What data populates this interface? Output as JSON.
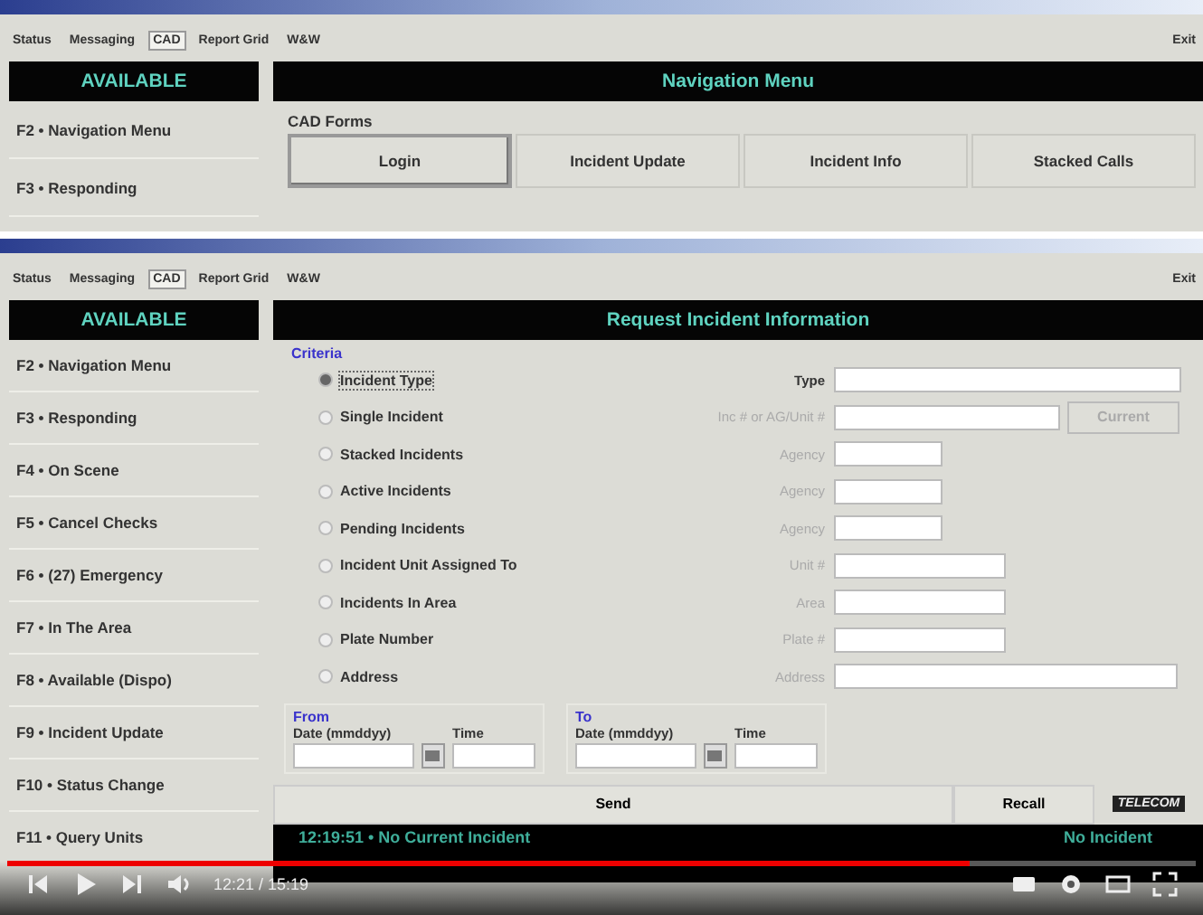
{
  "top_window": {
    "tabs": [
      {
        "label": "Status",
        "selected": false
      },
      {
        "label": "Messaging",
        "selected": false
      },
      {
        "label": "CAD",
        "selected": true
      },
      {
        "label": "Report Grid",
        "selected": false
      },
      {
        "label": "W&W",
        "selected": false
      }
    ],
    "exit": "Exit",
    "status_header": "AVAILABLE",
    "sidebar": [
      "F2 • Navigation Menu",
      "F3 • Responding"
    ],
    "header": "Navigation Menu",
    "section": "CAD Forms",
    "buttons": [
      {
        "label": "Login",
        "selected": true
      },
      {
        "label": "Incident Update",
        "selected": false
      },
      {
        "label": "Incident Info",
        "selected": false
      },
      {
        "label": "Stacked Calls",
        "selected": false
      }
    ]
  },
  "bottom_window": {
    "tabs": [
      {
        "label": "Status",
        "selected": false
      },
      {
        "label": "Messaging",
        "selected": false
      },
      {
        "label": "CAD",
        "selected": true
      },
      {
        "label": "Report Grid",
        "selected": false
      },
      {
        "label": "W&W",
        "selected": false
      }
    ],
    "exit": "Exit",
    "status_header": "AVAILABLE",
    "sidebar": [
      "F2 • Navigation Menu",
      "F3 • Responding",
      "F4 • On Scene",
      "F5 • Cancel Checks",
      "F6 • (27) Emergency",
      "F7 • In The Area",
      "F8 • Available (Dispo)",
      "F9 • Incident Update",
      "F10 • Status Change",
      "F11 • Query Units"
    ],
    "header": "Request Incident Information",
    "criteria_label": "Criteria",
    "rows": [
      {
        "option": "Incident Type",
        "selected": true,
        "label": "Type",
        "disabled": false,
        "kind": "dropdown"
      },
      {
        "option": "Single Incident",
        "selected": false,
        "label": "Inc # or AG/Unit #",
        "disabled": true,
        "kind": "medium-button"
      },
      {
        "option": "Stacked Incidents",
        "selected": false,
        "label": "Agency",
        "disabled": true,
        "kind": "short"
      },
      {
        "option": "Active Incidents",
        "selected": false,
        "label": "Agency",
        "disabled": true,
        "kind": "short"
      },
      {
        "option": "Pending Incidents",
        "selected": false,
        "label": "Agency",
        "disabled": true,
        "kind": "short"
      },
      {
        "option": "Incident Unit Assigned To",
        "selected": false,
        "label": "Unit #",
        "disabled": true,
        "kind": "medium"
      },
      {
        "option": "Incidents In Area",
        "selected": false,
        "label": "Area",
        "disabled": true,
        "kind": "medium"
      },
      {
        "option": "Plate Number",
        "selected": false,
        "label": "Plate #",
        "disabled": true,
        "kind": "medium"
      },
      {
        "option": "Address",
        "selected": false,
        "label": "Address",
        "disabled": true,
        "kind": "long"
      }
    ],
    "current_button": {
      "label": "Current",
      "disabled": true
    },
    "ranges": [
      {
        "title": "From",
        "date_label": "Date (mmddyy)",
        "time_label": "Time"
      },
      {
        "title": "To",
        "date_label": "Date (mmddyy)",
        "time_label": "Time"
      }
    ],
    "send": "Send",
    "recall": "Recall",
    "logo": "TELECOM",
    "status": "12:19:51 • No Current Incident",
    "status_right": "No Incident"
  },
  "video_player": {
    "time": "12:21 / 15:19",
    "level": 0.81
  }
}
